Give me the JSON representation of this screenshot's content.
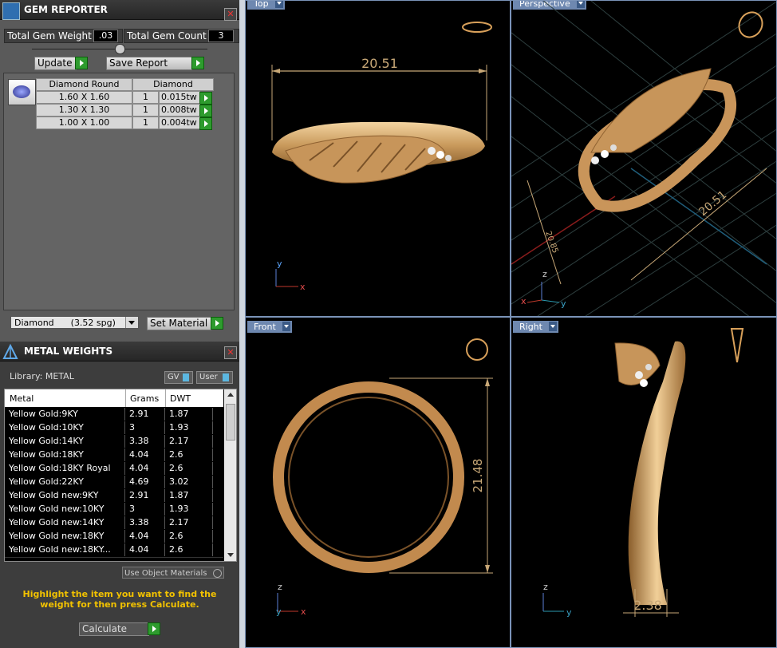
{
  "gem_reporter": {
    "title": "GEM REPORTER",
    "close_glyph": "✕",
    "total_weight_label": "Total Gem Weight",
    "total_weight_value": ".03",
    "total_count_label": "Total Gem Count",
    "total_count_value": "3",
    "update_label": "Update",
    "save_report_label": "Save Report",
    "columns": [
      "Diamond Round",
      "Diamond"
    ],
    "rows": [
      {
        "size": "1.60 X 1.60",
        "qty": "1",
        "weight": "0.015tw"
      },
      {
        "size": "1.30 X 1.30",
        "qty": "1",
        "weight": "0.008tw"
      },
      {
        "size": "1.00 X 1.00",
        "qty": "1",
        "weight": "0.004tw"
      }
    ],
    "material_select": "Diamond      (3.52 spg)",
    "set_material_label": "Set Material"
  },
  "metal_weights": {
    "title": "METAL WEIGHTS",
    "close_glyph": "✕",
    "library_label": "Library: METAL",
    "gv_label": "GV",
    "user_label": "User",
    "columns": [
      "Metal",
      "Grams",
      "DWT"
    ],
    "rows": [
      {
        "metal": "Yellow Gold:9KY",
        "grams": "2.91",
        "dwt": "1.87"
      },
      {
        "metal": "Yellow Gold:10KY",
        "grams": "3",
        "dwt": "1.93"
      },
      {
        "metal": "Yellow Gold:14KY",
        "grams": "3.38",
        "dwt": "2.17"
      },
      {
        "metal": "Yellow Gold:18KY",
        "grams": "4.04",
        "dwt": "2.6"
      },
      {
        "metal": "Yellow Gold:18KY Royal",
        "grams": "4.04",
        "dwt": "2.6"
      },
      {
        "metal": "Yellow Gold:22KY",
        "grams": "4.69",
        "dwt": "3.02"
      },
      {
        "metal": "Yellow Gold new:9KY",
        "grams": "2.91",
        "dwt": "1.87"
      },
      {
        "metal": "Yellow Gold new:10KY",
        "grams": "3",
        "dwt": "1.93"
      },
      {
        "metal": "Yellow Gold new:14KY",
        "grams": "3.38",
        "dwt": "2.17"
      },
      {
        "metal": "Yellow Gold new:18KY",
        "grams": "4.04",
        "dwt": "2.6"
      },
      {
        "metal": "Yellow Gold new:18KY...",
        "grams": "4.04",
        "dwt": "2.6"
      }
    ],
    "use_object_materials_label": "Use Object Materials",
    "hint": "Highlight the item you want to find the weight for then press Calculate.",
    "calculate_label": "Calculate"
  },
  "viewports": {
    "top": {
      "label": "Top",
      "dimension": "20.51",
      "axis_v": "y",
      "axis_h": "x"
    },
    "perspective": {
      "label": "Perspective",
      "dimension_long": "20.51",
      "dimension_short": "20.85",
      "axis_v": "z",
      "axis_x": "x",
      "axis_y": "y"
    },
    "front": {
      "label": "Front",
      "dimension": "21.48",
      "axis_v": "z",
      "axis_h": "x",
      "axis_side": "y"
    },
    "right": {
      "label": "Right",
      "dimension": "2.38",
      "axis_v": "z",
      "axis_h": "y"
    }
  },
  "colors": {
    "gold": "#d9b07a",
    "dimension": "#c8a877",
    "viewport_border": "#7a93b8",
    "hint_text": "#f2c200"
  }
}
